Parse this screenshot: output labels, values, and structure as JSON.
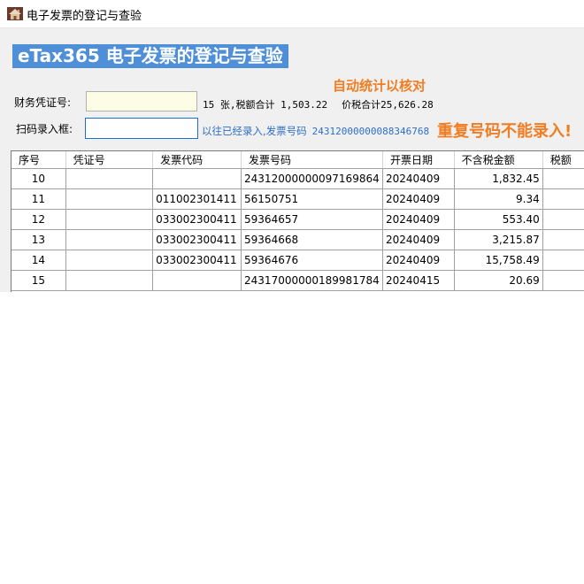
{
  "window": {
    "title": "电子发票的登记与查验"
  },
  "banner": {
    "text": "eTax365 电子发票的登记与查验"
  },
  "notes": {
    "auto_stats": "自动统计以核对",
    "no_duplicate": "重复号码不能录入!"
  },
  "form": {
    "voucher_label": "财务凭证号:",
    "voucher_value": "",
    "scan_label": "扫码录入框:",
    "scan_value": "",
    "summary_count": "15 张,税额合计 1,503.22",
    "summary_total": "价税合计25,626.28",
    "last_entered_label": "以往已经录入,发票号码",
    "last_entered_number": "24312000000088346768"
  },
  "table": {
    "columns": [
      "序号",
      "凭证号",
      "发票代码",
      "发票号码",
      "开票日期",
      "不含税金额",
      "税额"
    ],
    "rows": [
      {
        "seq": "10",
        "voucher": "",
        "code": "",
        "number": "24312000000097169864",
        "date": "20240409",
        "amount": "1,832.45",
        "tax": ""
      },
      {
        "seq": "11",
        "voucher": "",
        "code": "011002301411",
        "number": "56150751",
        "date": "20240409",
        "amount": "9.34",
        "tax": ""
      },
      {
        "seq": "12",
        "voucher": "",
        "code": "033002300411",
        "number": "59364657",
        "date": "20240409",
        "amount": "553.40",
        "tax": ""
      },
      {
        "seq": "13",
        "voucher": "",
        "code": "033002300411",
        "number": "59364668",
        "date": "20240409",
        "amount": "3,215.87",
        "tax": ""
      },
      {
        "seq": "14",
        "voucher": "",
        "code": "033002300411",
        "number": "59364676",
        "date": "20240409",
        "amount": "15,758.49",
        "tax": ""
      },
      {
        "seq": "15",
        "voucher": "",
        "code": "",
        "number": "24317000000189981784",
        "date": "20240415",
        "amount": "20.69",
        "tax": ""
      }
    ]
  },
  "colors": {
    "banner_bg": "#4f8fd8",
    "note_orange": "#f07d22",
    "link_blue": "#2f6fc6",
    "voucher_input_bg": "#fdfde6",
    "scan_input_border": "#1a6fd0"
  },
  "icons": {
    "app": "house-icon"
  }
}
